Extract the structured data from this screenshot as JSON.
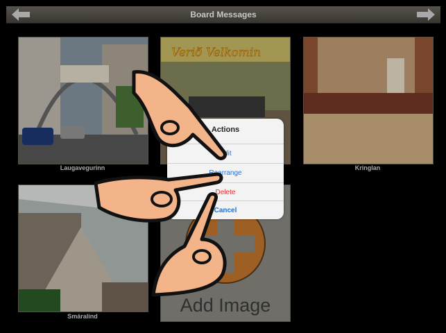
{
  "header": {
    "title": "Board Messages",
    "back_icon": "arrow-left-icon",
    "forward_icon": "arrow-right-icon"
  },
  "tiles": [
    {
      "caption": "Laugavegurinn"
    },
    {
      "caption": ""
    },
    {
      "caption": "Kringlan"
    },
    {
      "caption": "Smáralind"
    }
  ],
  "add_tile": {
    "label": "Add Image",
    "icon": "plus-circle-icon"
  },
  "action_sheet": {
    "title": "Actions",
    "items": [
      {
        "label": "Edit"
      },
      {
        "label": "Rearrange"
      },
      {
        "label": "Delete"
      },
      {
        "label": "Cancel"
      }
    ]
  },
  "colors": {
    "accent": "#1a73e8",
    "danger": "#e03030",
    "topbar": "#5d5952",
    "plus": "#c97a2e"
  }
}
